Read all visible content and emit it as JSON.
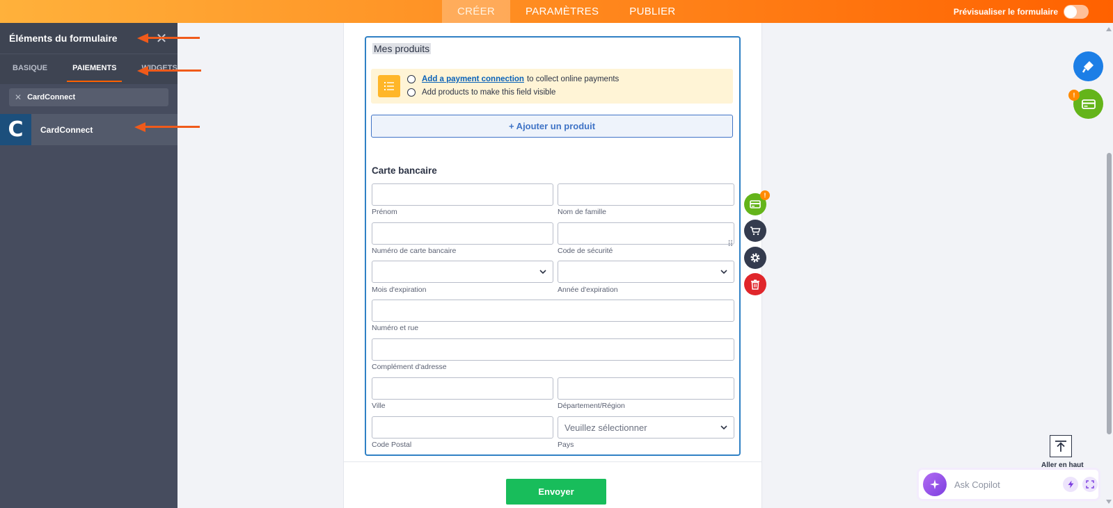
{
  "topbar": {
    "tabs": [
      {
        "label": "CRÉER",
        "active": true
      },
      {
        "label": "PARAMÈTRES",
        "active": false
      },
      {
        "label": "PUBLIER",
        "active": false
      }
    ],
    "preview_label": "Prévisualiser le formulaire"
  },
  "left_panel": {
    "title": "Éléments du formulaire",
    "tabs": [
      {
        "label": "BASIQUE",
        "active": false
      },
      {
        "label": "PAIEMENTS",
        "active": true
      },
      {
        "label": "WIDGETS",
        "active": false
      }
    ],
    "search_value": "CardConnect",
    "results": [
      {
        "logo_letter": "C",
        "name": "CardConnect"
      }
    ]
  },
  "form": {
    "products_title": "Mes produits",
    "warning": {
      "link_text": "Add a payment connection",
      "line1_rest": "to collect online payments",
      "line2": "Add products to make this field visible"
    },
    "add_product_label": "+ Ajouter un produit",
    "card_section_title": "Carte bancaire",
    "fields": {
      "first_name": "Prénom",
      "last_name": "Nom de famille",
      "card_number": "Numéro de carte bancaire",
      "security_code": "Code de sécurité",
      "exp_month": "Mois d'expiration",
      "exp_year": "Année d'expiration",
      "street": "Numéro et rue",
      "address2": "Complément d'adresse",
      "city": "Ville",
      "state": "Département/Région",
      "postal": "Code Postal",
      "country": "Pays",
      "country_placeholder": "Veuillez sélectionner"
    },
    "badge_text": "!",
    "submit_label": "Envoyer"
  },
  "right": {
    "go_top_label": "Aller en haut",
    "copilot_placeholder": "Ask Copilot",
    "badge_text": "!"
  },
  "colors": {
    "accent_orange": "#ff6100",
    "field_border_blue": "#2f80c4",
    "submit_green": "#18bd5b",
    "delete_red": "#e0262b",
    "payment_green": "#64b41a"
  }
}
